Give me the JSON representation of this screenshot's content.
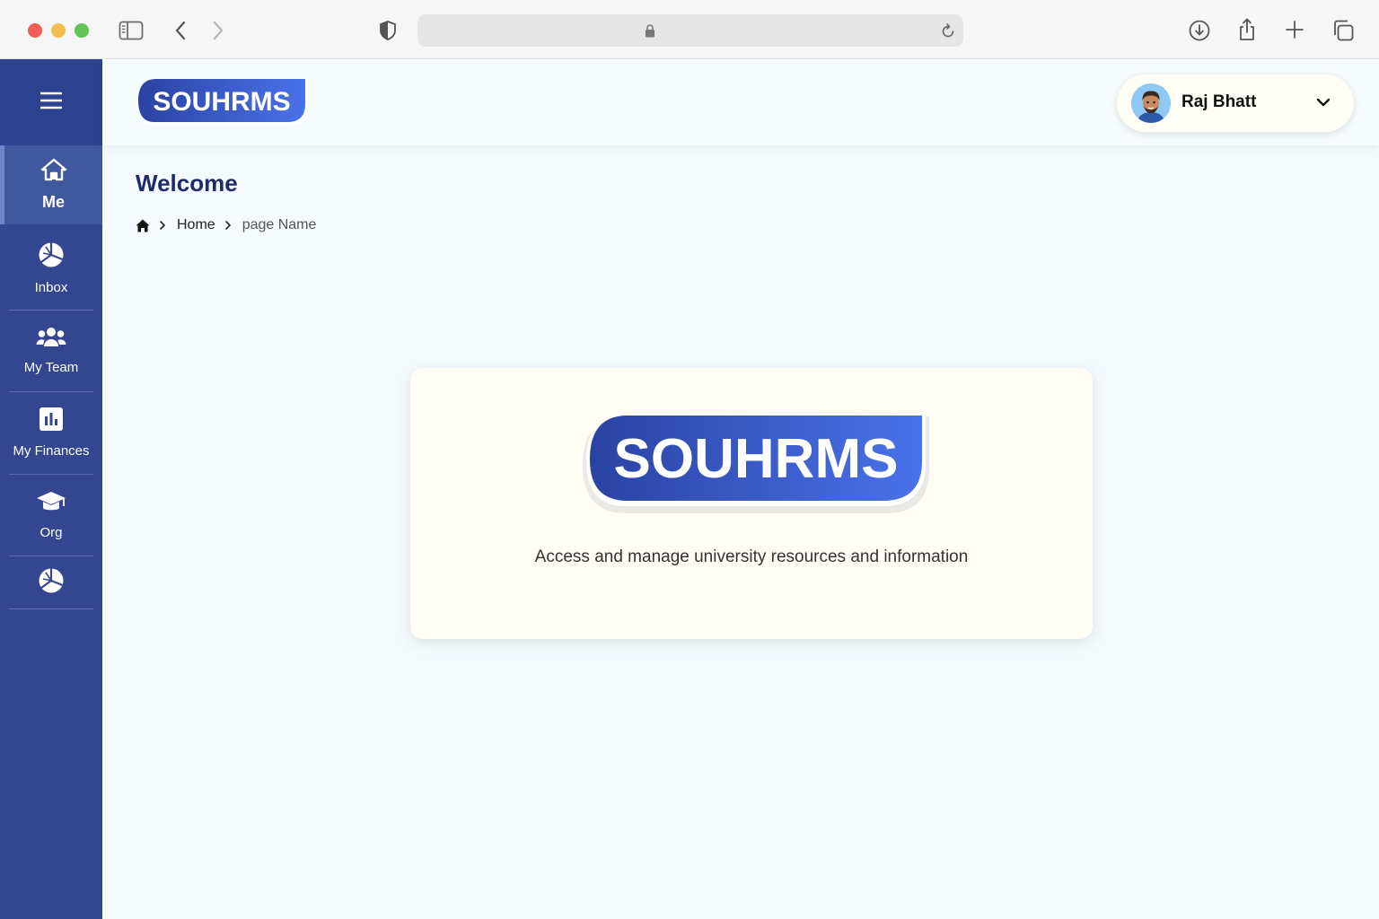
{
  "browser": {
    "icons": [
      "sidebar-toggle-icon",
      "back-icon",
      "forward-icon",
      "shield-icon",
      "lock-icon",
      "reload-icon",
      "download-icon",
      "share-icon",
      "new-tab-icon",
      "tabs-overview-icon"
    ]
  },
  "app": {
    "logo_text": "SOUHRMS",
    "brand_colors": {
      "sidebar": "#33468f",
      "accent": "#4a6ee8",
      "title": "#1d2c6b"
    }
  },
  "sidebar": {
    "menu_icon": "hamburger-icon",
    "items": [
      {
        "label": "Me",
        "icon": "home-icon",
        "active": true
      },
      {
        "label": "Inbox",
        "icon": "pie-chart-icon",
        "active": false
      },
      {
        "label": "My Team",
        "icon": "team-icon",
        "active": false
      },
      {
        "label": "My Finances",
        "icon": "bar-chart-icon",
        "active": false
      },
      {
        "label": "Org",
        "icon": "graduation-cap-icon",
        "active": false
      },
      {
        "label": "",
        "icon": "pie-chart-icon",
        "active": false
      }
    ]
  },
  "header": {
    "user": {
      "name": "Raj Bhatt",
      "avatar_icon": "avatar-icon",
      "dropdown_icon": "chevron-down-icon"
    }
  },
  "page": {
    "title": "Welcome",
    "breadcrumb": {
      "home_icon": "home-icon",
      "items": [
        "Home",
        "page Name"
      ]
    }
  },
  "card": {
    "logo_text": "SOUHRMS",
    "description": "Access and manage university resources and information"
  }
}
